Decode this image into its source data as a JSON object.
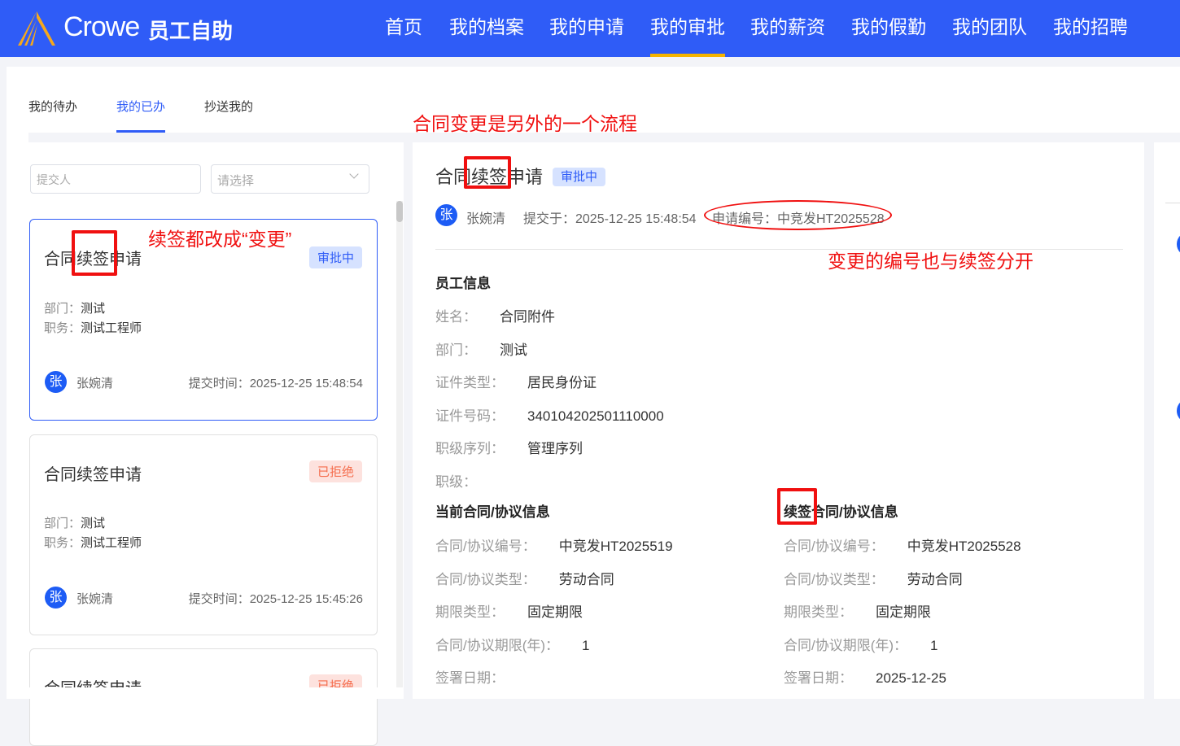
{
  "header": {
    "brand": "Crowe",
    "app_name": "员工自助",
    "nav": [
      "首页",
      "我的档案",
      "我的申请",
      "我的审批",
      "我的薪资",
      "我的假勤",
      "我的团队",
      "我的招聘"
    ],
    "active_nav": "我的审批",
    "accent": "#2f5cf7"
  },
  "tabs": [
    "我的待办",
    "我的已办",
    "抄送我的"
  ],
  "filters": {
    "submitter_placeholder": "提交人",
    "select_placeholder": "请选择"
  },
  "cards": [
    {
      "title": "合同续签申请",
      "status": "审批中",
      "dept_label": "部门：",
      "dept": "测试",
      "job_label": "职务：",
      "job": "测试工程师",
      "avatar": "张",
      "name": "张婉清",
      "time_label": "提交时间：",
      "time": "2025-12-25 15:48:54"
    },
    {
      "title": "合同续签申请",
      "status": "已拒绝",
      "dept_label": "部门：",
      "dept": "测试",
      "job_label": "职务：",
      "job": "测试工程师",
      "avatar": "张",
      "name": "张婉清",
      "time_label": "提交时间：",
      "time": "2025-12-25 15:45:26"
    },
    {
      "title": "合同续签申请",
      "status": "已拒绝"
    }
  ],
  "detail": {
    "title": "合同续签申请",
    "status": "审批中",
    "avatar": "张",
    "name": "张婉清",
    "submitted": "提交于：2025-12-25 15:48:54",
    "app_no": "申请编号：中竞发HT2025528",
    "employee_section": "员工信息",
    "employee": [
      {
        "label": "姓名：",
        "value": "合同附件"
      },
      {
        "label": "部门：",
        "value": "测试"
      },
      {
        "label": "证件类型：",
        "value": "居民身份证"
      },
      {
        "label": "证件号码：",
        "value": "340104202501110000"
      },
      {
        "label": "职级序列：",
        "value": "管理序列"
      },
      {
        "label": "职级：",
        "value": ""
      }
    ],
    "current_section": "当前合同/协议信息",
    "current": [
      {
        "label": "合同/协议编号：",
        "value": "中竞发HT2025519"
      },
      {
        "label": "合同/协议类型：",
        "value": "劳动合同"
      },
      {
        "label": "期限类型：",
        "value": "固定期限"
      },
      {
        "label": "合同/协议期限(年)：",
        "value": "1"
      },
      {
        "label": "签署日期：",
        "value": ""
      }
    ],
    "renew_section": "续签合同/协议信息",
    "renew": [
      {
        "label": "合同/协议编号：",
        "value": "中竞发HT2025528"
      },
      {
        "label": "合同/协议类型：",
        "value": "劳动合同"
      },
      {
        "label": "期限类型：",
        "value": "固定期限"
      },
      {
        "label": "合同/协议期限(年)：",
        "value": "1"
      },
      {
        "label": "签署日期：",
        "value": "2025-12-25"
      }
    ]
  },
  "annotations": {
    "a1": "合同变更是另外的一个流程",
    "a2": "续签都改成“变更”",
    "a3": "变更的编号也与续签分开",
    "color": "#f01010"
  }
}
